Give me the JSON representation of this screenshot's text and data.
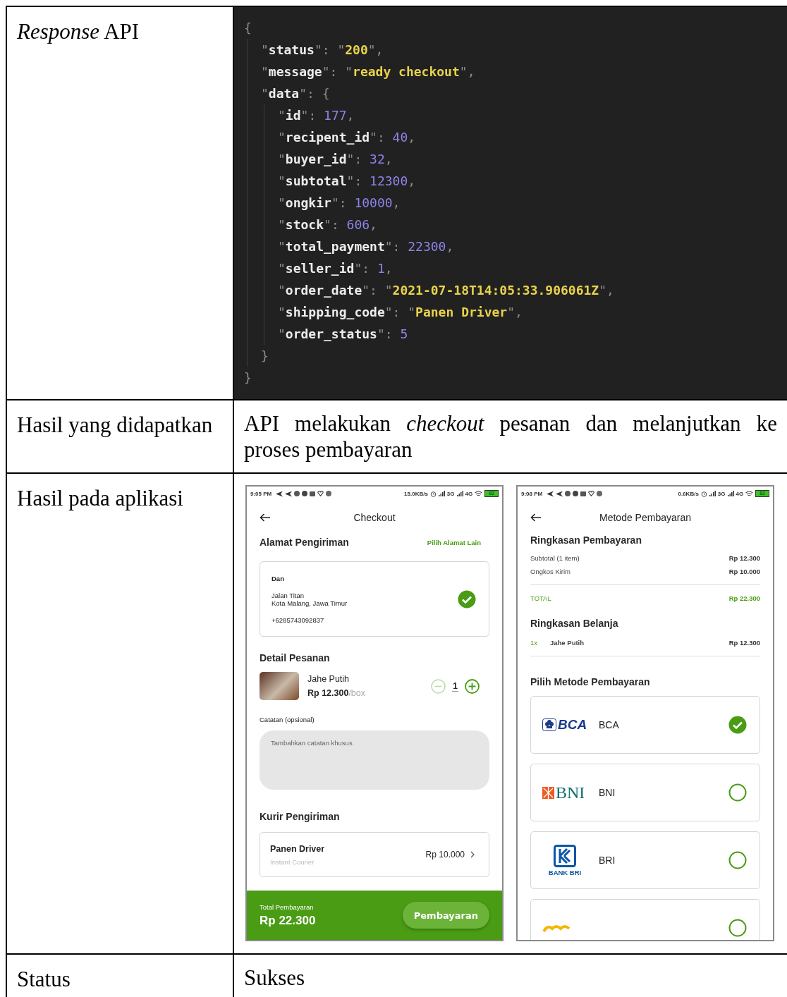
{
  "table": {
    "rows": [
      {
        "kind": "code",
        "label": "*Response* API",
        "code_lines": [
          {
            "text": "{",
            "children": [
              {
                "text": "\"status\": \"200\","
              },
              {
                "text": "\"message\": \"ready checkout\","
              },
              {
                "text": "\"data\": {",
                "children": [
                  {
                    "text": "\"id\": 177,"
                  },
                  {
                    "text": "\"recipent_id\": 40,"
                  },
                  {
                    "text": "\"buyer_id\": 32,"
                  },
                  {
                    "text": "\"subtotal\": 12300,"
                  },
                  {
                    "text": "\"ongkir\": 10000,"
                  },
                  {
                    "text": "\"stock\": 606,"
                  },
                  {
                    "text": "\"total_payment\": 22300,"
                  },
                  {
                    "text": "\"seller_id\": 1,"
                  },
                  {
                    "text": "\"order_date\": \"2021-07-18T14:05:33.906061Z\","
                  },
                  {
                    "text": "\"shipping_code\": \"Panen Driver\","
                  },
                  {
                    "text": "\"order_status\": 5"
                  }
                ]
              },
              {
                "text": "}"
              }
            ]
          },
          {
            "text": "}"
          }
        ]
      },
      {
        "kind": "text",
        "label": "Hasil yang didapatkan",
        "value": "API melakukan *checkout* pesanan dan melanjutkan ke proses pembayaran"
      },
      {
        "kind": "screens",
        "label": "Hasil pada aplikasi",
        "screens": [
          {
            "kind": "checkout",
            "status_bar": {
              "time": "9:05 PM",
              "speed": "15.0KB/s",
              "network_1": "3G",
              "network_2": "4G",
              "battery": "82"
            },
            "title": "Checkout",
            "address": {
              "heading": "Alamat Pengiriman",
              "link": "Pilih Alamat Lain",
              "name": "Dan",
              "lines": [
                "Jalan Titan",
                "Kota Malang, Jawa Timur"
              ],
              "phone": "+6285743092837",
              "selected": true
            },
            "detail": {
              "heading": "Detail Pesanan",
              "product": "Jahe Putih",
              "price": "Rp 12.300",
              "unit": "/box",
              "quantity": "1",
              "minus_disabled": true
            },
            "note": {
              "label": "Catatan (opsional)",
              "placeholder": "Tambahkan catatan khusus"
            },
            "courier": {
              "heading": "Kurir Pengiriman",
              "name": "Panen Driver",
              "type": "Instant Courier",
              "price": "Rp 10.000"
            },
            "footer": {
              "label": "Total Pembayaran",
              "total": "Rp 22.300",
              "button": "Pembayaran"
            }
          },
          {
            "kind": "payment",
            "status_bar": {
              "time": "9:08 PM",
              "speed": "0.6KB/s",
              "network_1": "3G",
              "network_2": "4G",
              "battery": "82"
            },
            "title": "Metode Pembayaran",
            "summary": {
              "heading": "Ringkasan Pembayaran",
              "rows": [
                {
                  "label": "Subtotal (1 item)",
                  "value": "Rp 12.300"
                },
                {
                  "label": "Ongkos Kirim",
                  "value": "Rp 10.000"
                }
              ],
              "total": {
                "label": "TOTAL",
                "value": "Rp 22.300"
              }
            },
            "shopping": {
              "heading": "Ringkasan Belanja",
              "items": [
                {
                  "qty": "1x",
                  "name": "Jahe Putih",
                  "price": "Rp 12.300"
                }
              ]
            },
            "methods_heading": "Pilih Metode Pembayaran",
            "methods": [
              {
                "kind": "bca",
                "logo_text": "BCA",
                "label": "BCA",
                "selected": true
              },
              {
                "kind": "bni",
                "logo_text": "BNI",
                "label": "BNI",
                "selected": false
              },
              {
                "kind": "bri",
                "logo_text": "BANK BRI",
                "label": "BRI",
                "selected": false
              },
              {
                "kind": "mandiri",
                "selected": false
              }
            ]
          }
        ]
      },
      {
        "kind": "text",
        "label": "Status",
        "value": "Sukses"
      }
    ]
  }
}
